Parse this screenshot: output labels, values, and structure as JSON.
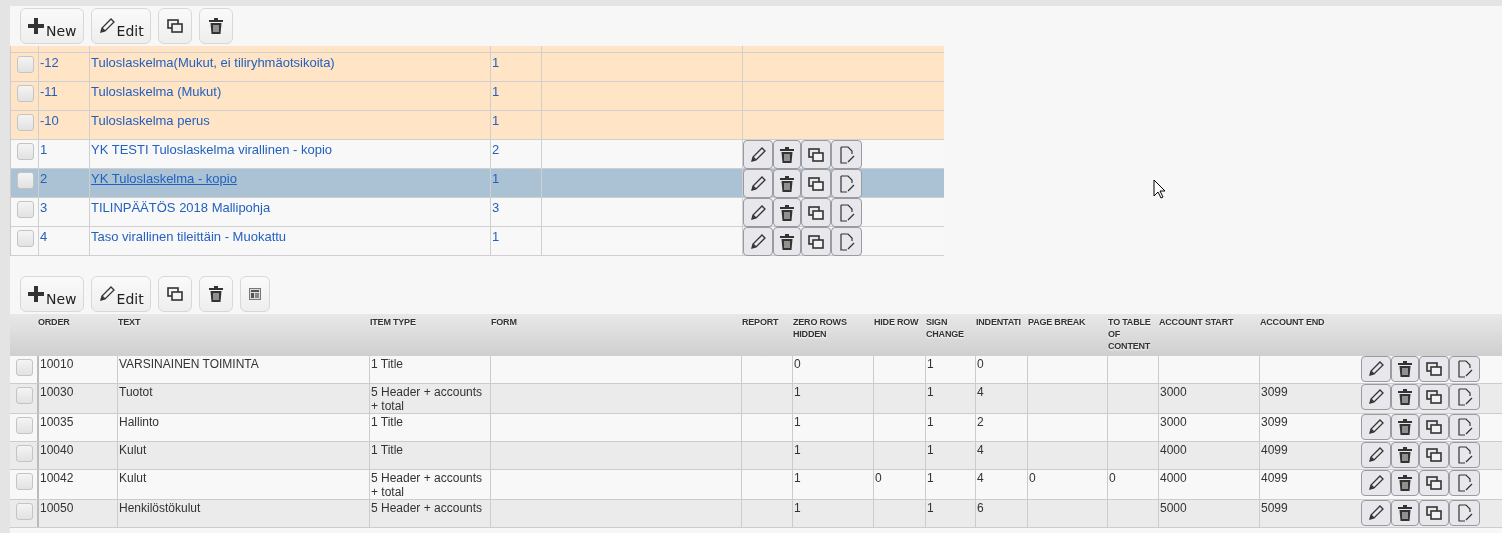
{
  "top_panel": {
    "toolbar": [
      {
        "kind": "new",
        "label": "New"
      },
      {
        "kind": "edit",
        "label": "Edit"
      },
      {
        "kind": "copy"
      },
      {
        "kind": "delete"
      }
    ],
    "rows": [
      {
        "kind": "builtin",
        "checked": false,
        "selected": false,
        "id": "-12",
        "name": "Tuloslaskelma(Mukut, ei tiliryhmäotsikoita)",
        "form": "1"
      },
      {
        "kind": "builtin",
        "checked": false,
        "selected": false,
        "id": "-11",
        "name": "Tuloslaskelma (Mukut)",
        "form": "1"
      },
      {
        "kind": "builtin",
        "checked": false,
        "selected": false,
        "id": "-10",
        "name": "Tuloslaskelma perus",
        "form": "1"
      },
      {
        "kind": "custom",
        "checked": false,
        "selected": false,
        "id": "1",
        "name": "YK TESTI Tuloslaskelma virallinen - kopio",
        "form": "2"
      },
      {
        "kind": "custom",
        "checked": false,
        "selected": true,
        "id": "2",
        "name": "YK Tuloslaskelma - kopio",
        "form": "1"
      },
      {
        "kind": "custom",
        "checked": false,
        "selected": false,
        "id": "3",
        "name": "TILINPÄÄTÖS 2018 Mallipohja",
        "form": "3"
      },
      {
        "kind": "custom",
        "checked": false,
        "selected": false,
        "id": "4",
        "name": "Taso virallinen tileittäin - Muokattu",
        "form": "1"
      }
    ]
  },
  "bottom_panel": {
    "toolbar": [
      {
        "kind": "new",
        "label": "New"
      },
      {
        "kind": "edit",
        "label": "Edit"
      },
      {
        "kind": "copy"
      },
      {
        "kind": "delete"
      },
      {
        "kind": "layout"
      }
    ],
    "columns": [
      "ORDER",
      "TEXT",
      "ITEM TYPE",
      "FORM",
      "REPORT",
      "ZERO ROWS HIDDEN",
      "HIDE ROW",
      "SIGN CHANGE",
      "INDENTATI",
      "PAGE BREAK",
      "TO TABLE OF CONTENT",
      "ACCOUNT START",
      "ACCOUNT END"
    ],
    "rows": [
      {
        "checked": false,
        "cells": [
          "10010",
          "VARSINAINEN TOIMINTA",
          "1 Title",
          null,
          null,
          "0",
          null,
          "1",
          "0",
          null,
          null,
          null,
          null
        ]
      },
      {
        "checked": false,
        "cells": [
          "10030",
          "Tuotot",
          "5 Header + accounts + total",
          null,
          null,
          "1",
          null,
          "1",
          "4",
          null,
          null,
          "3000",
          "3099"
        ]
      },
      {
        "checked": false,
        "cells": [
          "10035",
          "Hallinto",
          "1 Title",
          null,
          null,
          "1",
          null,
          "1",
          "2",
          null,
          null,
          "3000",
          "3099"
        ]
      },
      {
        "checked": false,
        "cells": [
          "10040",
          "Kulut",
          "1 Title",
          null,
          null,
          "1",
          null,
          "1",
          "4",
          null,
          null,
          "4000",
          "4099"
        ]
      },
      {
        "checked": false,
        "cells": [
          "10042",
          "Kulut",
          "5 Header + accounts + total",
          null,
          null,
          "1",
          "0",
          "1",
          "4",
          "0",
          "0",
          "4000",
          "4099"
        ]
      },
      {
        "checked": false,
        "cells": [
          "10050",
          "Henkilöstökulut",
          "5 Header + accounts",
          null,
          null,
          "1",
          null,
          "1",
          "6",
          null,
          null,
          "5000",
          "5099"
        ]
      }
    ]
  }
}
